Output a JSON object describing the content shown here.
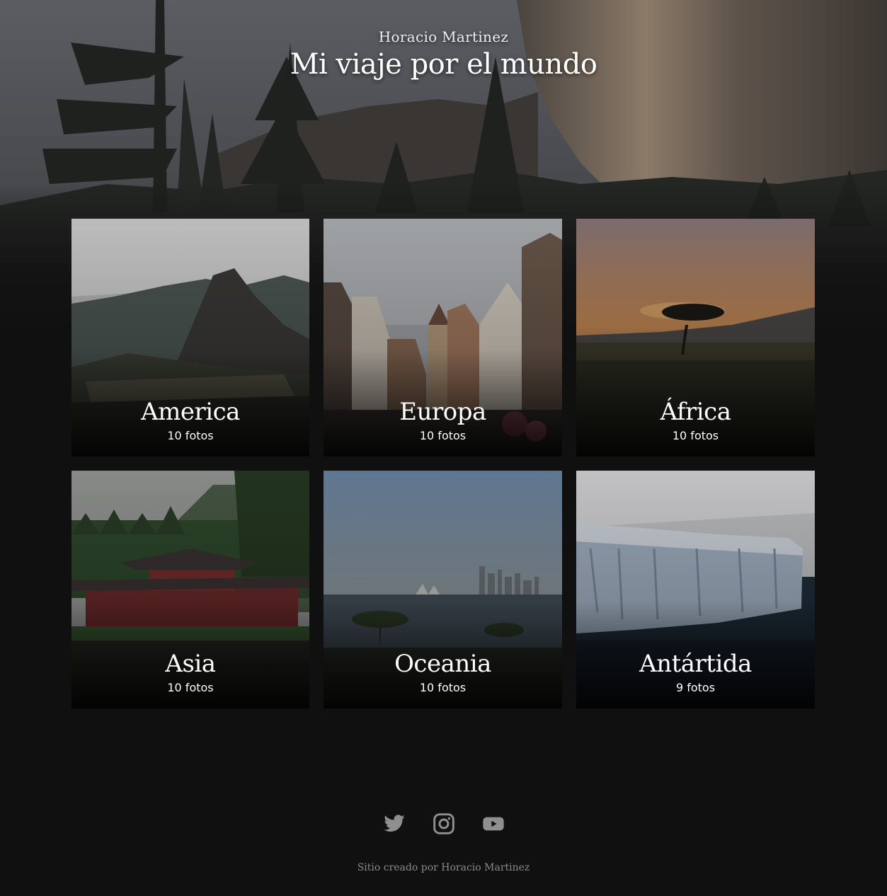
{
  "header": {
    "author": "Horacio Martinez",
    "title": "Mi viaje por el mundo"
  },
  "albums": [
    {
      "title": "America",
      "count": "10 fotos",
      "scene": "mountain-ruins"
    },
    {
      "title": "Europa",
      "count": "10 fotos",
      "scene": "old-town-street"
    },
    {
      "title": "África",
      "count": "10 fotos",
      "scene": "savanna-sunset"
    },
    {
      "title": "Asia",
      "count": "10 fotos",
      "scene": "temple-lake"
    },
    {
      "title": "Oceania",
      "count": "10 fotos",
      "scene": "harbour-skyline"
    },
    {
      "title": "Antártida",
      "count": "9 fotos",
      "scene": "ice-shelf"
    }
  ],
  "footer": {
    "social": [
      "twitter-icon",
      "instagram-icon",
      "youtube-icon"
    ],
    "credits": "Sitio creado por Horacio Martinez"
  },
  "colors": {
    "background": "#101010",
    "icon": "#8f8f8f",
    "credits": "#8a8a8a"
  }
}
